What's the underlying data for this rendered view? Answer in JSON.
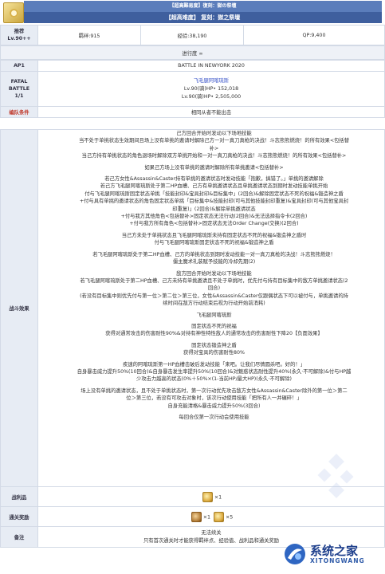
{
  "header": {
    "banner_top": "【超高難易度】復刻：獄の祭壇",
    "banner_main": "【超高难度】 复刻：獄之祭壇"
  },
  "info": {
    "recommend_label": "推荐\nLv.90++",
    "bond": "羁绊:915",
    "exp": "经验:38,190",
    "qp": "QP:9,400"
  },
  "progress": {
    "label": "进行度 ∞"
  },
  "ap": {
    "label": "AP1",
    "battle": "BATTLE IN NEWYORK 2020"
  },
  "fatal": {
    "label": "FATAL\nBATTLE\n1/1",
    "enemy_name": "飞毛腿阿喀琉斯",
    "enemy_lv1": "Lv.90(骑)HP• 152,018",
    "enemy_lv2": "Lv.90(骑)HP• 2,505,000"
  },
  "formation": {
    "label": "编队条件",
    "value": "相同从者不能出击"
  },
  "effects": {
    "label": "战斗效果",
    "lines": [
      "己方回合开始时发动以下场地技能",
      "当不处于单挑状态生效期间且场上没有单挑的邀请时解除己方一对一真刀真枪的决战！斗志熊熊燃烧！的所有效果<包括替",
      "补>",
      "当己方持有单挑状态的角色退场时解除双方单挑开始和一对一真刀真枪的决战！斗志熊熊燃烧！的所有效果<包括替补>",
      "",
      "如果己方场上没有单挑的邀请时解除所有单挑邀请<包括替补>",
      "",
      "若己方女性&Assassin&Caster持有单挑的邀请状态时发动技能「抱歉，搞错了。」单挑的邀请解除",
      "若己方飞毛腿阿喀琉斯处于第二HP血槽、己方有单挑邀请状态且单挑邀请状态到期时发动技能单挑开始",
      "付与飞毛腿阿喀琉斯固定状态单挑「技能封印&宝具封印&目标集中」(2回合)&解除固定状态不死的祝福&锻造神之盾",
      "+付与具有单挑的邀请状态的角色固定状态单挑「目标集中&技能封印(可与其他技能封印重复)&宝具封印(可与其他宝具封",
      "印重复)」(2回合)&解除单挑邀请状态",
      "+付与我方其他角色<包括替补>固定状态无法行动(2回合)&无法选择指令卡(2回合)",
      "+付与我方所有角色<包括替补>固定状态无法Order Change(交换)(2回合)",
      "",
      "当己方未处于单挑状态且飞毛腿阿喀琉斯未持有固定状态不死的祝福&锻造神之盾时",
      "付与飞毛腿阿喀琉斯固定状态不死的祝福&锻造神之盾",
      "",
      "若飞毛腿阿喀琉斯处于第二HP血槽、己方的单挑状态到期时发动技能一对一真刀真枪的决战！斗志熊熊燃烧！",
      "僵主魔术礼装赋予技能的冷却先期(2)",
      "",
      "敌方回合开始时发动以下场地技能",
      "若飞毛腿阿喀琉斯处于第二HP血槽、己方未持有单挑邀请且不处于单挑时，优先付与持有目标集中的敌方单挑邀请状态(2",
      "回合)",
      "(若没有目标集中则优先付与第一位＞第二位＞第三位，女性&Assassin&Caster仅跟偶状态下可以被付与，单挑邀请的持",
      "续时间在敌方行动结束后视为行动开始前消耗)",
      "",
      "飞毛腿阿喀琉斯",
      "",
      "固定状态不死的祝福",
      "获得对通常攻击的伤害耐性90%&对持有神性特性敌人的通常攻击的伤害耐性下降20【负面效果】",
      "",
      "固定状态锻造神之盾",
      "获得对宝具的伤害耐性80%",
      "",
      "疾速的阿喀琉斯第一HP血槽击破后发动技能「来吧。让我们尽情圆杀吧。好的！」",
      "自身暴击威力提升50%(10回合)&自身暴击发生率提升50%(10回合)&对魅惑状态耐性提升40%(永久·不可解除)&付与HP越",
      "少攻击力越高的状态(0%＋50%×(1-当前HP/最大HP)(永久·不可解除)",
      "",
      "场上没有单挑的邀请状态，且不处于单挑状态时，第一次行动优先攻击敌方女性&Assassin&Caster除外的第一位＞第二",
      "位＞第三位，若没有可攻击对象时，该次行动使用技能「把所有人一并碾碎！」",
      "自身充能清格&暴击威力提升50%(3回合)",
      "",
      "每回合仅第一次行动会使用技能"
    ]
  },
  "drops": {
    "label": "战利品",
    "count": "×1"
  },
  "rewards": {
    "label": "通关奖励",
    "count1": "×1",
    "count2": "×5"
  },
  "notes": {
    "label": "备注",
    "line1": "无法续关",
    "line2": "只有首次通关时才能获得羁绊点、经验值、战利品和通关奖励"
  },
  "watermark": {
    "brand": "系统之家",
    "sub": "XITONGWANG"
  }
}
